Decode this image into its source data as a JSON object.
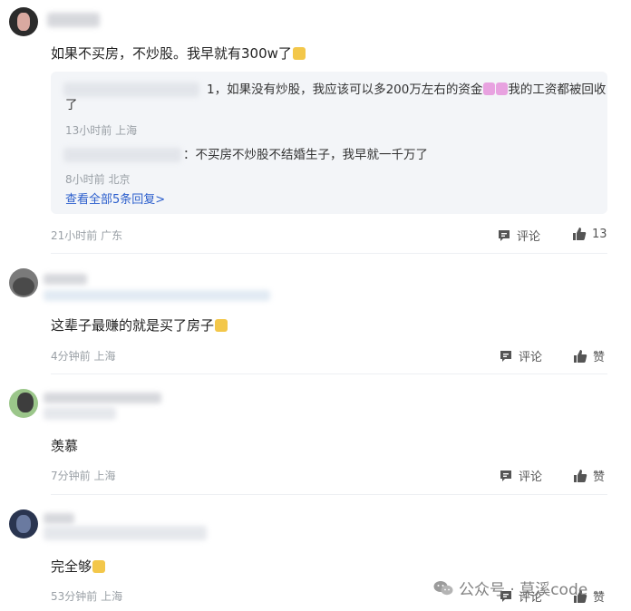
{
  "comments": [
    {
      "text": "如果不买房，不炒股。我早就有300w了",
      "meta": "21小时前 广东",
      "comment_label": "评论",
      "like_label": "13",
      "replies": [
        {
          "text_tail": "1，如果没有炒股，我应该可以多200万左右的资金",
          "text_tail2": "我的工资都被回收",
          "text_wrap": "了",
          "meta": "13小时前 上海"
        },
        {
          "text_tail": "：不买房不炒股不结婚生子，我早就一千万了",
          "meta": "8小时前 北京"
        }
      ],
      "view_all": "查看全部5条回复>"
    },
    {
      "text": "这辈子最赚的就是买了房子",
      "meta": "4分钟前 上海",
      "comment_label": "评论",
      "like_label": "赞"
    },
    {
      "text": "羡慕",
      "meta": "7分钟前 上海",
      "comment_label": "评论",
      "like_label": "赞"
    },
    {
      "text": "完全够",
      "meta": "53分钟前 上海",
      "comment_label": "评论",
      "like_label": "赞"
    }
  ],
  "watermark": "公众号 · 莫溪code",
  "icons": {
    "comment": "comment-icon",
    "like": "thumbs-up-icon",
    "wechat": "wechat-icon"
  }
}
